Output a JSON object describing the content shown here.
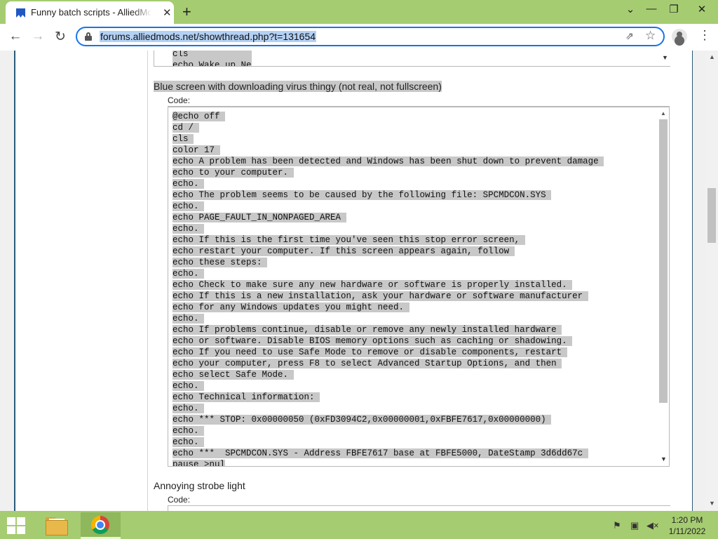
{
  "browser": {
    "tab_title": "Funny batch scripts - AlliedModders",
    "tab_close": "✕",
    "new_tab": "+",
    "window_controls": {
      "minimize": "⌄",
      "restore": "—",
      "maximize": "❐",
      "close": "✕"
    },
    "nav": {
      "back": "←",
      "forward": "→",
      "reload": "↻"
    },
    "url": "forums.alliedmods.net/showthread.php?t=131654",
    "share": "⇗",
    "bookmark": "☆",
    "menu": "⋮"
  },
  "page": {
    "previous_code_tail": "cls\necho Wake up Ne",
    "post_title": "Blue screen with downloading virus thingy (not real, not fullscreen)",
    "code_label": "Code:",
    "code_lines": [
      "@echo off ",
      "cd / ",
      "cls ",
      "color 17 ",
      "echo A problem has been detected and Windows has been shut down to prevent damage ",
      "echo to your computer. ",
      "echo. ",
      "echo The problem seems to be caused by the following file: SPCMDCON.SYS ",
      "echo. ",
      "echo PAGE_FAULT_IN_NONPAGED_AREA ",
      "echo. ",
      "echo If this is the first time you've seen this stop error screen, ",
      "echo restart your computer. If this screen appears again, follow ",
      "echo these steps: ",
      "echo. ",
      "echo Check to make sure any new hardware or software is properly installed. ",
      "echo If this is a new installation, ask your hardware or software manufacturer ",
      "echo for any Windows updates you might need. ",
      "echo. ",
      "echo If problems continue, disable or remove any newly installed hardware ",
      "echo or software. Disable BIOS memory options such as caching or shadowing. ",
      "echo If you need to use Safe Mode to remove or disable components, restart ",
      "echo your computer, press F8 to select Advanced Startup Options, and then ",
      "echo select Safe Mode. ",
      "echo. ",
      "echo Technical information: ",
      "echo. ",
      "echo *** STOP: 0x00000050 (0xFD3094C2,0x00000001,0xFBFE7617,0x00000000) ",
      "echo. ",
      "echo. ",
      "echo ***  SPCMDCON.SYS - Address FBFE7617 base at FBFE5000, DateStamp 3d6dd67c ",
      "pause >nul"
    ],
    "second_post_title": "Annoying strobe light",
    "second_code_label": "Code:"
  },
  "taskbar": {
    "time": "1:20 PM",
    "date": "1/11/2022",
    "tray_icons": [
      "flag-icon",
      "network-icon",
      "volume-muted-icon"
    ]
  }
}
